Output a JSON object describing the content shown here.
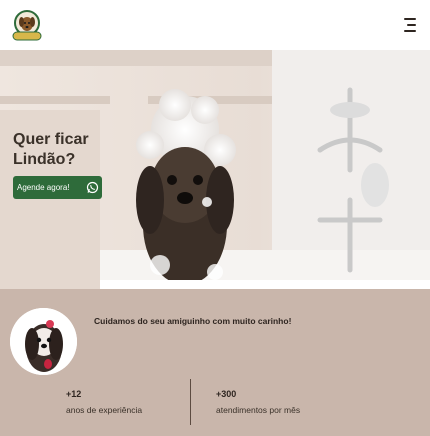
{
  "header": {
    "logo_icon": "dog-logo-icon",
    "menu_icon": "hamburger-menu-icon"
  },
  "hero": {
    "title": "Quer ficar Lindão?",
    "cta_label": "Agende agora!",
    "cta_icon": "whatsapp-icon",
    "image": "dog-in-bath-with-foam"
  },
  "info": {
    "tagline": "Cuidamos do seu amiguinho com muito carinho!",
    "avatar_image": "shih-tzu-dog-avatar",
    "stats": [
      {
        "value": "+12",
        "label": "anos de experiência"
      },
      {
        "value": "+300",
        "label": "atendimentos por mês"
      }
    ]
  },
  "colors": {
    "cta_background": "#2e6b3a",
    "info_background": "#c9b6ab",
    "title_text": "#3a3129"
  }
}
